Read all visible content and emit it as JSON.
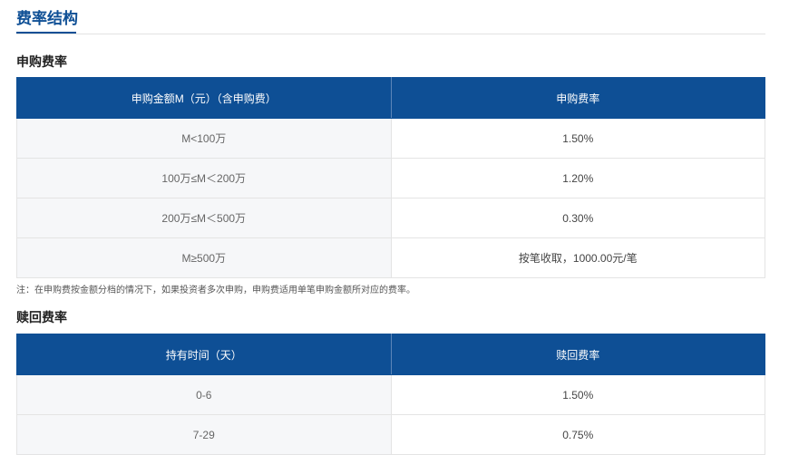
{
  "page": {
    "title": "费率结构"
  },
  "subscription": {
    "title": "申购费率",
    "headers": [
      "申购金额M（元）（含申购费）",
      "申购费率"
    ],
    "rows": [
      [
        "M<100万",
        "1.50%"
      ],
      [
        "100万≤M＜200万",
        "1.20%"
      ],
      [
        "200万≤M＜500万",
        "0.30%"
      ],
      [
        "M≥500万",
        "按笔收取，1000.00元/笔"
      ]
    ],
    "note": "注：在申购费按金额分档的情况下，如果投资者多次申购，申购费适用单笔申购金额所对应的费率。"
  },
  "redemption": {
    "title": "赎回费率",
    "headers": [
      "持有时间（天）",
      "赎回费率"
    ],
    "rows": [
      [
        "0-6",
        "1.50%"
      ],
      [
        "7-29",
        "0.75%"
      ]
    ]
  },
  "colors": {
    "header_bg": "#0e4f95",
    "title": "#0e4f95",
    "left_cell_bg": "#f6f7f9"
  }
}
